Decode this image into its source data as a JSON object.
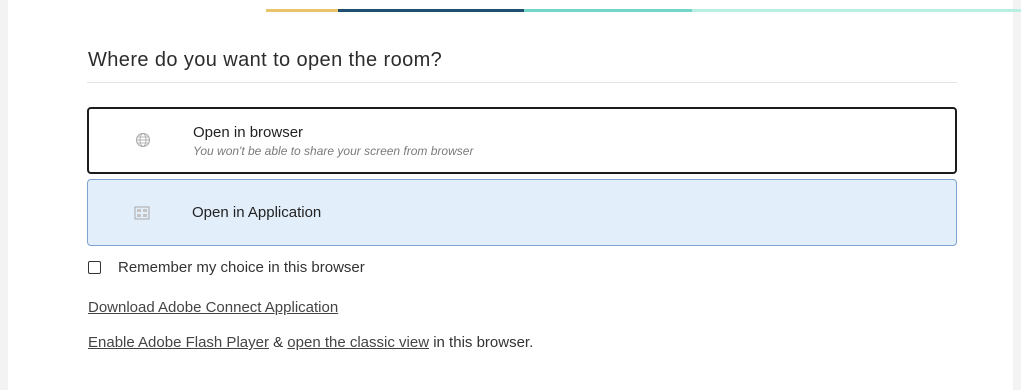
{
  "dialog": {
    "title": "Where do you want to open the room?",
    "options": [
      {
        "label": "Open in browser",
        "sublabel": "You won't be able to share your screen from browser",
        "icon": "globe-icon",
        "selected": false
      },
      {
        "label": "Open in Application",
        "icon": "application-icon",
        "selected": true
      }
    ],
    "remember": {
      "label": "Remember my choice in this browser",
      "checked": false
    },
    "download_link": "Download Adobe Connect Application",
    "flash_line": {
      "enable_link": "Enable Adobe Flash Player",
      "ampersand": " & ",
      "classic_link": "open the classic view",
      "suffix": " in this browser."
    }
  },
  "colors": {
    "selected_bg": "#e3eefb",
    "selected_border": "#7ea3cf",
    "focus_border": "#1c1c1c"
  }
}
